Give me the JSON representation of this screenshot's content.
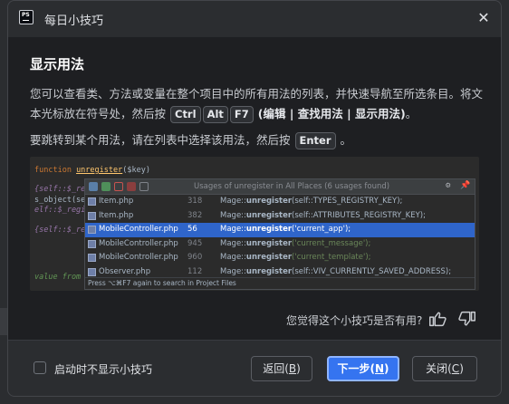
{
  "window": {
    "title": "每日小技巧",
    "app_icon_text": "PS"
  },
  "tip": {
    "heading": "显示用法",
    "p1_text": "您可以查看类、方法或变量在整个项目中的所有用法的列表，并快速导航至所选条目。将文本光标放在符号处，然后按",
    "keys": [
      "Ctrl",
      "Alt",
      "F7"
    ],
    "p1_action": "(编辑 | 查找用法 | 显示用法)",
    "p1_end": "。",
    "p2_text": "要跳转到某个用法，请在列表中选择该用法，然后按",
    "p2_key": "Enter",
    "p2_end": "。"
  },
  "screenshot": {
    "code_lines": [
      {
        "a": "function ",
        "b": "unregister",
        "c": "($key)"
      },
      {
        "a": "{self::$_regis"
      },
      {
        "a": "s_object(sel"
      },
      {
        "a": "elf::$_regist"
      },
      {
        "a": "{self::$_regis"
      },
      {
        "a": "value from"
      }
    ],
    "popup_title": "Usages of unregister in All Places (6 usages found)",
    "rows": [
      {
        "file": "Item.php",
        "line": "318",
        "pre": "Mage::",
        "method": "unregister",
        "arg": "(self::TYPES_REGISTRY_KEY);",
        "str": false
      },
      {
        "file": "Item.php",
        "line": "382",
        "pre": "Mage::",
        "method": "unregister",
        "arg": "(self::ATTRIBUTES_REGISTRY_KEY);",
        "str": false
      },
      {
        "file": "MobileController.php",
        "line": "56",
        "pre": "Mage::",
        "method": "unregister",
        "arg": "('current_app');",
        "str": true
      },
      {
        "file": "MobileController.php",
        "line": "945",
        "pre": "Mage::",
        "method": "unregister",
        "arg": "('current_message');",
        "str": true
      },
      {
        "file": "MobileController.php",
        "line": "960",
        "pre": "Mage::",
        "method": "unregister",
        "arg": "('current_template');",
        "str": true
      },
      {
        "file": "Observer.php",
        "line": "112",
        "pre": "Mage::",
        "method": "unregister",
        "arg": "(self::VIV_CURRENTLY_SAVED_ADDRESS);",
        "str": false
      }
    ],
    "selected_index": 2,
    "footer": "Press ⌥⌘F7 again to search in Project Files"
  },
  "feedback": {
    "question": "您觉得这个小技巧是否有用?"
  },
  "footer": {
    "checkbox_label": "启动时不显示小技巧",
    "checked": false,
    "back": "返回(",
    "back_key": "B",
    "next": "下一步(",
    "next_key": "N",
    "close": "关闭(",
    "close_key": "C",
    "paren_close": ")"
  },
  "colors": {
    "accent": "#3574f0",
    "selection": "#2f65ca",
    "background": "#1e1f22",
    "dialog": "#2b2d30"
  }
}
